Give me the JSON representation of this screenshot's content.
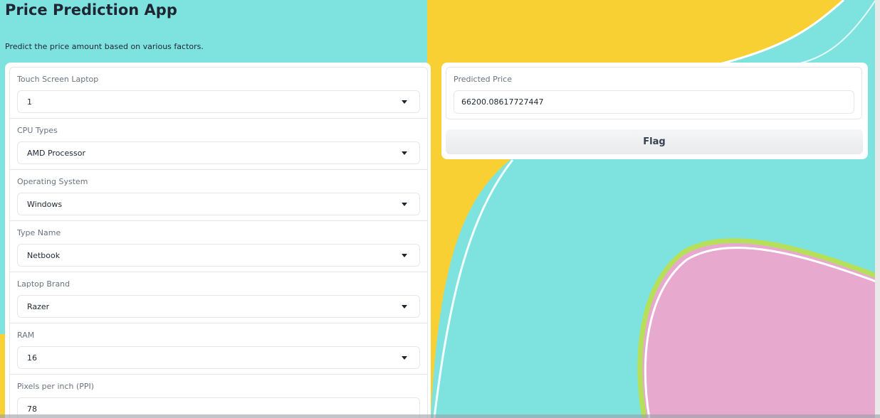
{
  "app": {
    "title": "Price Prediction App",
    "description": "Predict the price amount based on various factors."
  },
  "inputs": [
    {
      "label": "Touch Screen Laptop",
      "value": "1"
    },
    {
      "label": "CPU Types",
      "value": "AMD Processor"
    },
    {
      "label": "Operating System",
      "value": "Windows"
    },
    {
      "label": "Type Name",
      "value": "Netbook"
    },
    {
      "label": "Laptop Brand",
      "value": "Razer"
    },
    {
      "label": "RAM",
      "value": "16"
    },
    {
      "label": "Pixels per inch (PPI)",
      "value": "78"
    }
  ],
  "output": {
    "label": "Predicted Price",
    "value": "66200.08617727447"
  },
  "flag_button": {
    "label": "Flag"
  },
  "colors": {
    "background_teal": "#7ee3df",
    "background_yellow": "#f7cf3a",
    "background_pink": "#e8a9cf"
  }
}
